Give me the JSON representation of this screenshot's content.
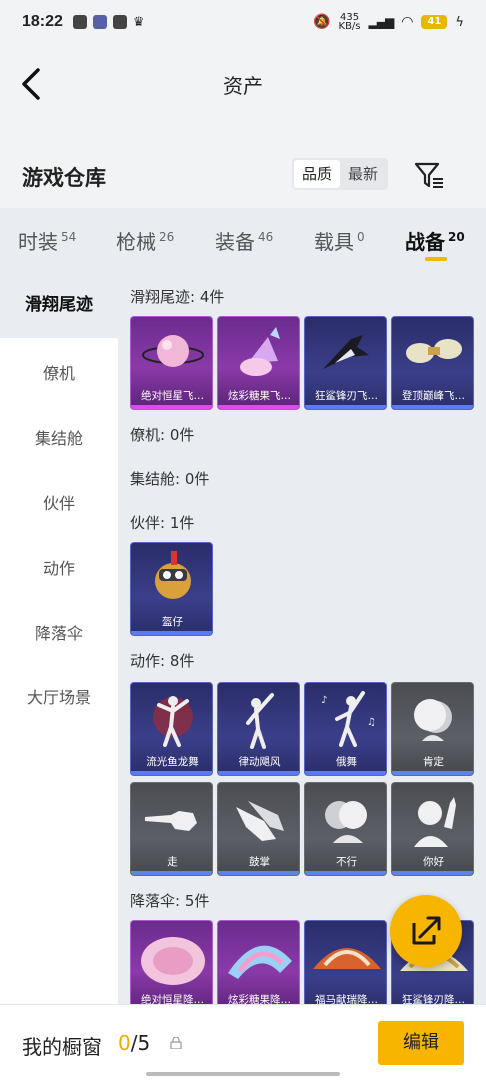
{
  "status": {
    "time": "18:22",
    "net_speed": "435\nKB/s",
    "battery": "41"
  },
  "header": {
    "title": "资产"
  },
  "warehouse": {
    "title": "游戏仓库",
    "sort_quality": "品质",
    "sort_latest": "最新"
  },
  "tabs": [
    {
      "label": "时装",
      "count": "54"
    },
    {
      "label": "枪械",
      "count": "26"
    },
    {
      "label": "装备",
      "count": "46"
    },
    {
      "label": "载具",
      "count": "0"
    },
    {
      "label": "战备",
      "count": "20"
    }
  ],
  "nav": [
    "滑翔尾迹",
    "僚机",
    "集结舱",
    "伙伴",
    "动作",
    "降落伞",
    "大厅场景"
  ],
  "sections": {
    "glide": {
      "title": "滑翔尾迹: 4件",
      "items": [
        "绝对恒星飞…",
        "炫彩糖果飞…",
        "狂鲨锋刃飞…",
        "登顶巅峰飞…"
      ]
    },
    "wingman": {
      "title": "僚机: 0件"
    },
    "pod": {
      "title": "集结舱: 0件"
    },
    "partner": {
      "title": "伙伴: 1件",
      "items": [
        "盔仔"
      ]
    },
    "emote": {
      "title": "动作: 8件",
      "items": [
        "流光鱼龙舞",
        "律动飓风",
        "俄舞",
        "肯定",
        "走",
        "鼓掌",
        "不行",
        "你好"
      ]
    },
    "parachute": {
      "title": "降落伞: 5件",
      "items": [
        "绝对恒星降…",
        "炫彩糖果降…",
        "福马献瑞降…",
        "狂鲨锋刃降…"
      ]
    }
  },
  "bottom": {
    "showcase_label": "我的橱窗",
    "showcase_current": "0",
    "showcase_total": "/5",
    "edit_label": "编辑"
  },
  "colors": {
    "accent": "#f7b500",
    "purple_rarity": "#d84ee8",
    "blue_rarity": "#5b7cf0"
  }
}
